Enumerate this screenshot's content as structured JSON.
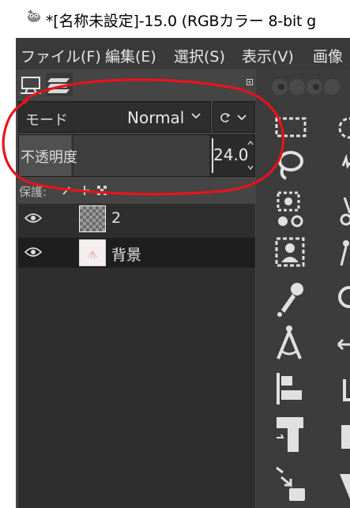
{
  "window": {
    "title": "*[名称未設定]-15.0 (RGBカラー 8-bit g"
  },
  "menubar": {
    "items": [
      {
        "label": "ファイル(F)"
      },
      {
        "label": "編集(E)"
      },
      {
        "label": "選択(S)"
      },
      {
        "label": "表示(V)"
      },
      {
        "label": "画像"
      }
    ]
  },
  "layers_panel": {
    "tabs": [
      {
        "icon": "display-icon",
        "active": true
      },
      {
        "icon": "layers-icon",
        "active": false
      }
    ],
    "mode": {
      "label": "モード",
      "value": "Normal"
    },
    "opacity": {
      "label": "不透明度",
      "value": "24.0"
    },
    "lock": {
      "label": "保護:"
    },
    "layers": [
      {
        "name": "2",
        "visible": true,
        "selected": false,
        "thumb": "transparent"
      },
      {
        "name": "背景",
        "visible": true,
        "selected": true,
        "thumb": "white"
      }
    ]
  },
  "annotation": {
    "color": "#e8131b"
  },
  "colors": {
    "panel_bg": "#454545",
    "toolbox_bg": "#3c3c3c",
    "menubar_bg": "#3a3a3a",
    "selected_row": "#1e1e1e",
    "icon": "#e0e0e0"
  }
}
